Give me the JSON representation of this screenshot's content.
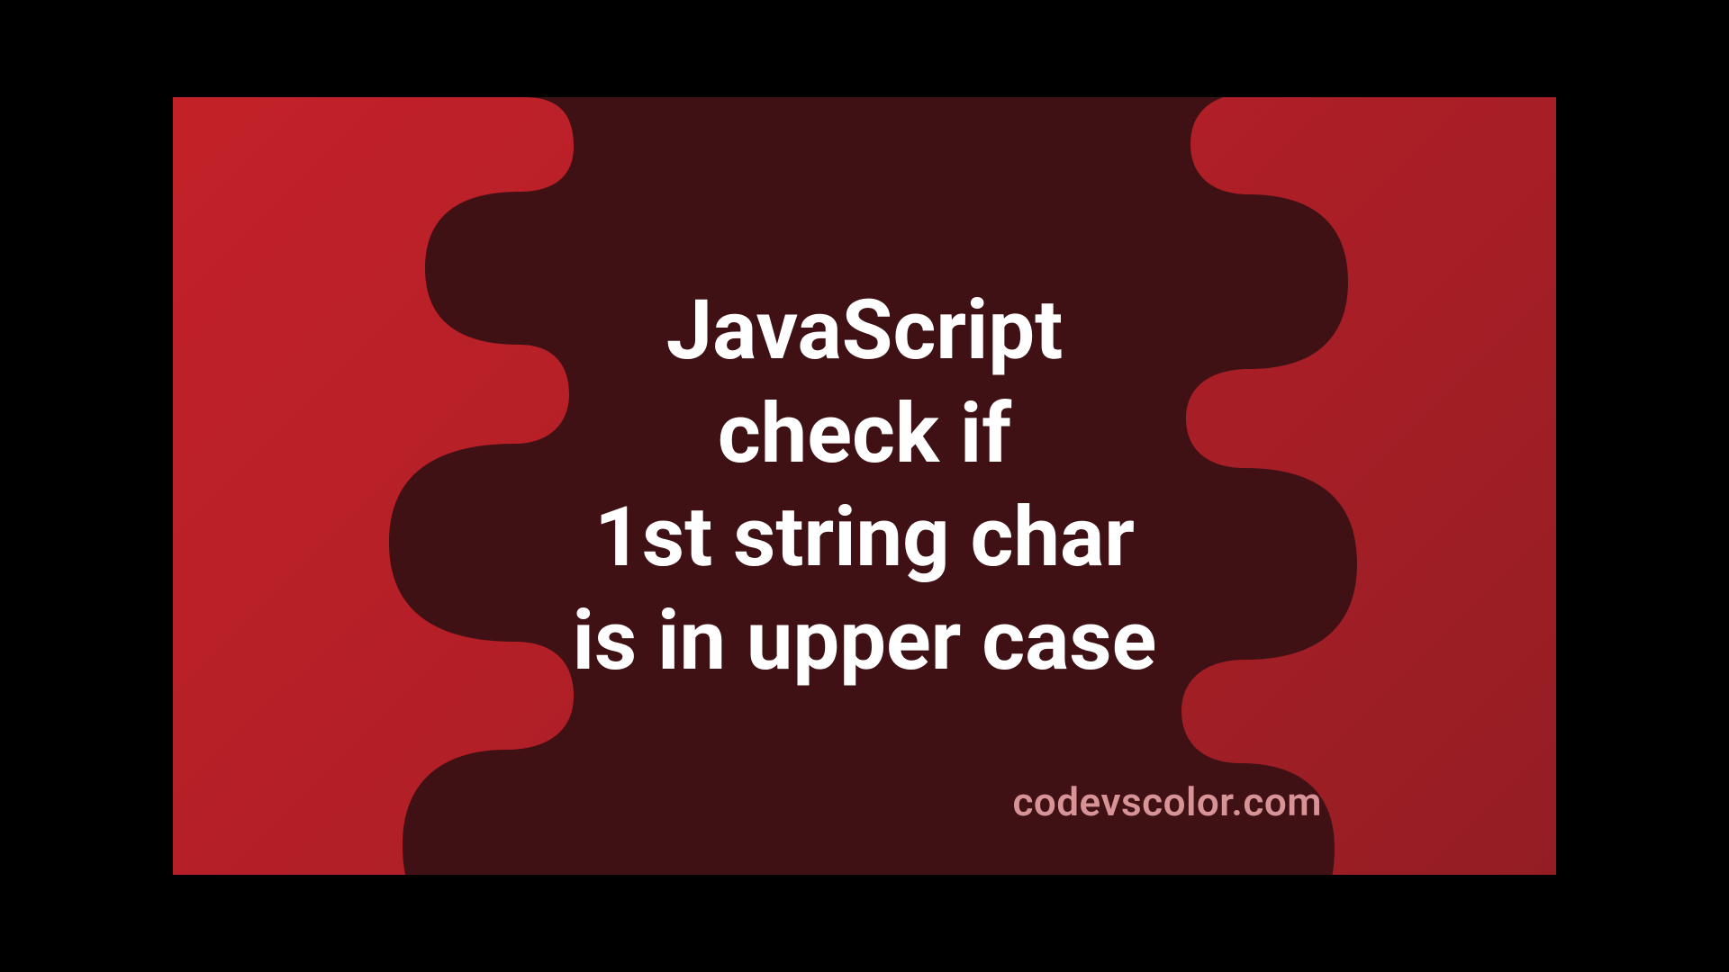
{
  "headline": {
    "line1": "JavaScript",
    "line2": "check if",
    "line3": "1st string char",
    "line4": "is in upper case"
  },
  "watermark": "codevscolor.com",
  "colors": {
    "bg_gradient_start": "#c32128",
    "bg_gradient_end": "#941d24",
    "blob": "#3f1114",
    "text": "#ffffff",
    "watermark": "#d89396"
  }
}
